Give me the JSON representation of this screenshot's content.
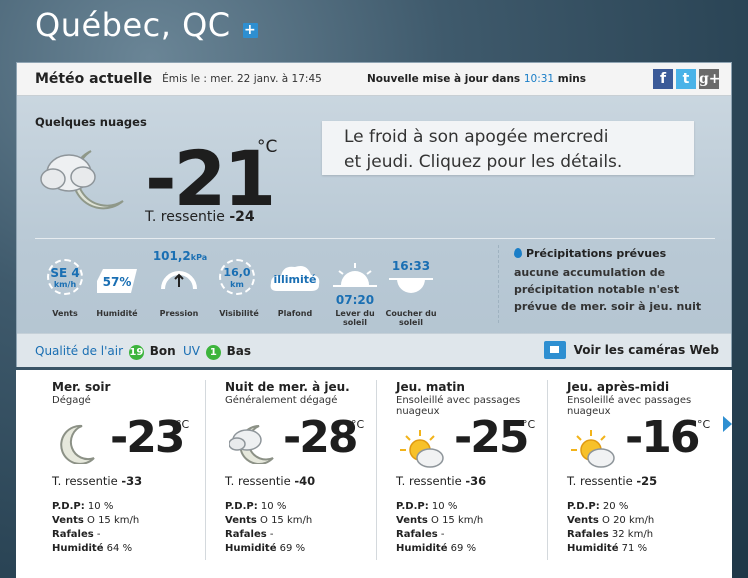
{
  "location": {
    "city": "Québec, QC"
  },
  "header": {
    "title": "Météo actuelle",
    "issued": "Émis le : mer. 22 janv. à 17:45",
    "update_prefix": "Nouvelle mise à jour dans",
    "update_value": "10:31",
    "update_suffix": "mins"
  },
  "social": {
    "facebook": "f",
    "twitter": "t",
    "gplus": "g+"
  },
  "current": {
    "condition": "Quelques nuages",
    "temp": "-21",
    "unit": "°C",
    "feels_label": "T. ressentie",
    "feels_value": "-24",
    "banner_line1": "Le froid à son apogée mercredi",
    "banner_line2": "et jeudi. Cliquez pour les détails."
  },
  "stats": {
    "wind_dir": "SE 4",
    "wind_unit": "km/h",
    "wind_label": "Vents",
    "humidity": "57%",
    "humidity_label": "Humidité",
    "pressure": "101,2",
    "pressure_unit": "kPa",
    "pressure_label": "Pression",
    "visibility": "16,0",
    "visibility_unit": "km",
    "visibility_label": "Visibilité",
    "ceiling": "illimité",
    "ceiling_label": "Plafond",
    "sunrise": "07:20",
    "sunrise_label": "Lever du soleil",
    "sunset": "16:33",
    "sunset_label": "Coucher du soleil"
  },
  "precip": {
    "title": "Précipitations prévues",
    "text": "aucune accumulation de précipitation notable n'est prévue de mer. soir à jeu. nuit"
  },
  "air": {
    "quality_label": "Qualité de l'air",
    "quality_value": "19",
    "quality_text": "Bon",
    "uv_label": "UV",
    "uv_value": "1",
    "uv_text": "Bas",
    "webcam": "Voir les caméras Web"
  },
  "forecast": [
    {
      "title": "Mer. soir",
      "sub": "Dégagé",
      "temp": "-23",
      "unit": "°C",
      "feels_label": "T. ressentie",
      "feels": "-33",
      "pdp_label": "P.D.P:",
      "pdp": "10 %",
      "winds_label": "Vents",
      "winds": "O 15 km/h",
      "gusts_label": "Rafales",
      "gusts": "-",
      "hum_label": "Humidité",
      "hum": "64 %",
      "icon": "moon-icon"
    },
    {
      "title": "Nuit de mer. à jeu.",
      "sub": "Généralement dégagé",
      "temp": "-28",
      "unit": "°C",
      "feels_label": "T. ressentie",
      "feels": "-40",
      "pdp_label": "P.D.P:",
      "pdp": "10 %",
      "winds_label": "Vents",
      "winds": "O 15 km/h",
      "gusts_label": "Rafales",
      "gusts": "-",
      "hum_label": "Humidité",
      "hum": "69 %",
      "icon": "moon-cloud-icon"
    },
    {
      "title": "Jeu. matin",
      "sub": "Ensoleillé avec passages nuageux",
      "temp": "-25",
      "unit": "°C",
      "feels_label": "T. ressentie",
      "feels": "-36",
      "pdp_label": "P.D.P:",
      "pdp": "10 %",
      "winds_label": "Vents",
      "winds": "O 15 km/h",
      "gusts_label": "Rafales",
      "gusts": "-",
      "hum_label": "Humidité",
      "hum": "69 %",
      "icon": "sun-cloud-icon"
    },
    {
      "title": "Jeu. après-midi",
      "sub": "Ensoleillé avec passages nuageux",
      "temp": "-16",
      "unit": "°C",
      "feels_label": "T. ressentie",
      "feels": "-25",
      "pdp_label": "P.D.P:",
      "pdp": "20 %",
      "winds_label": "Vents",
      "winds": "O 20 km/h",
      "gusts_label": "Rafales",
      "gusts": "32 km/h",
      "hum_label": "Humidité",
      "hum": "71 %",
      "icon": "sun-cloud-icon"
    }
  ]
}
